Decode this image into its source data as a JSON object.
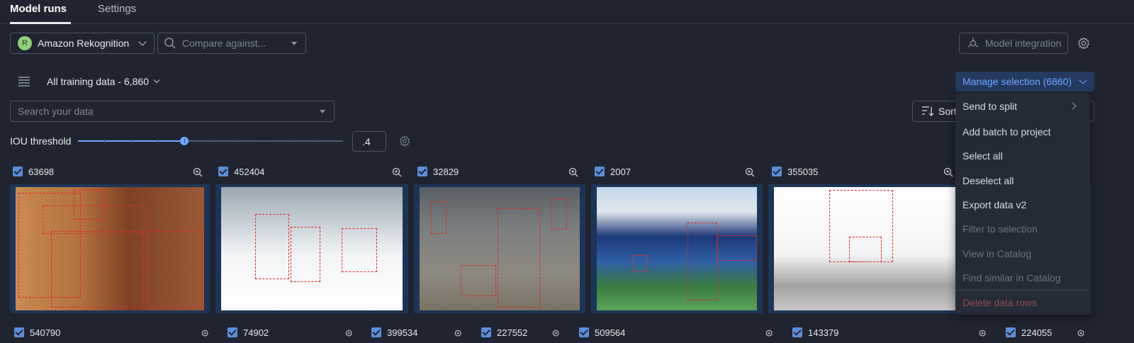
{
  "tabs": [
    {
      "label": "Model runs",
      "active": true
    },
    {
      "label": "Settings",
      "active": false
    }
  ],
  "toolbar": {
    "model": {
      "initial": "R",
      "name": "Amazon Rekognition",
      "avatar_color": "#8ed17a"
    },
    "compare_placeholder": "Compare against...",
    "integration_label": "Model integration"
  },
  "dataset": {
    "label": "All training data - 6,860"
  },
  "manage_selection": {
    "label": "Manage selection (6860)"
  },
  "search": {
    "placeholder": "Search your data"
  },
  "sort": {
    "label": "Sort"
  },
  "iou": {
    "label": "IOU threshold",
    "value": ".4",
    "slider_fraction": 0.4
  },
  "menu": {
    "items": [
      {
        "label": "Send to split",
        "disabled": false,
        "has_submenu": true
      },
      {
        "label": "Add batch to project",
        "disabled": false
      },
      {
        "label": "Select all",
        "disabled": false
      },
      {
        "label": "Deselect all",
        "disabled": false
      },
      {
        "label": "Export data v2",
        "disabled": false
      },
      {
        "label": "Filter to selection",
        "disabled": true
      },
      {
        "label": "View in Catalog",
        "disabled": true
      },
      {
        "label": "Find similar in Catalog",
        "disabled": true
      },
      {
        "label": "Delete data rows",
        "disabled": true,
        "danger": true
      }
    ]
  },
  "rows": {
    "top": [
      {
        "id": "63698",
        "checked": true
      },
      {
        "id": "452404",
        "checked": true
      },
      {
        "id": "32829",
        "checked": true
      },
      {
        "id": "2007",
        "checked": true
      },
      {
        "id": "355035",
        "checked": true
      }
    ],
    "bottom": [
      {
        "id": "540790",
        "checked": true
      },
      {
        "id": "74902",
        "checked": true
      },
      {
        "id": "399534",
        "checked": true
      },
      {
        "id": "227552",
        "checked": true
      },
      {
        "id": "509564",
        "checked": true
      },
      {
        "id": "143379",
        "checked": true
      },
      {
        "id": "224055",
        "checked": true
      }
    ]
  },
  "colors": {
    "accent": "#6fa6ff",
    "bbox": "#e02a2a",
    "background": "#1f2430"
  }
}
